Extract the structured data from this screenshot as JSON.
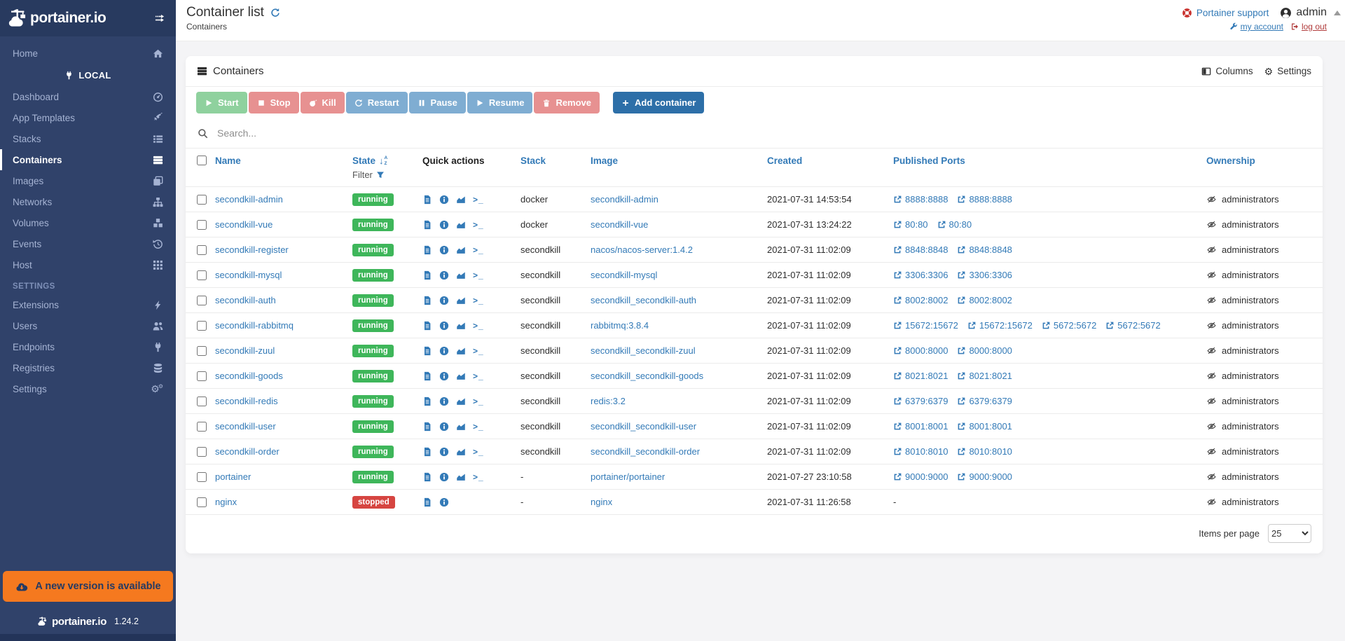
{
  "colors": {
    "blue": "#337ab7",
    "sidebar-bg": "#30426a",
    "sidebar-top": "#283a5f",
    "sidebar-text": "#a5b3d3",
    "orange": "#f5791f",
    "green": "#3eb65a",
    "red": "#d64541",
    "btn-green": "#8fd19e",
    "btn-red": "#e79191",
    "btn-blue": "#7fadd2",
    "btn-primary": "#2d6fa8",
    "logout-red": "#b13c3c",
    "text-dark": "#333333",
    "page-bg": "#f4f4f6"
  },
  "sidebar": {
    "logo_text": "portainer.io",
    "version": "1.24.2",
    "update_banner": "A new version is available",
    "local_label": "LOCAL",
    "settings_label": "SETTINGS",
    "menu": [
      {
        "label": "Home",
        "icon": "home"
      }
    ],
    "local_items": [
      {
        "label": "Dashboard",
        "icon": "gauge"
      },
      {
        "label": "App Templates",
        "icon": "rocket"
      },
      {
        "label": "Stacks",
        "icon": "stacks"
      },
      {
        "label": "Containers",
        "icon": "containers",
        "active": true
      },
      {
        "label": "Images",
        "icon": "images"
      },
      {
        "label": "Networks",
        "icon": "network"
      },
      {
        "label": "Volumes",
        "icon": "volumes"
      },
      {
        "label": "Events",
        "icon": "history"
      },
      {
        "label": "Host",
        "icon": "grid"
      }
    ],
    "settings_items": [
      {
        "label": "Extensions",
        "icon": "bolt"
      },
      {
        "label": "Users",
        "icon": "users"
      },
      {
        "label": "Endpoints",
        "icon": "plug"
      },
      {
        "label": "Registries",
        "icon": "db"
      },
      {
        "label": "Settings",
        "icon": "gears"
      }
    ]
  },
  "header": {
    "title": "Container list",
    "subtitle": "Containers",
    "support": "Portainer support",
    "user": "admin",
    "my_account": "my account",
    "log_out": "log out"
  },
  "panel": {
    "title": "Containers",
    "columns_label": "Columns",
    "settings_label": "Settings",
    "search_placeholder": "Search...",
    "buttons": [
      {
        "label": "Start",
        "icon": "play",
        "variant": "green"
      },
      {
        "label": "Stop",
        "icon": "stop",
        "variant": "red"
      },
      {
        "label": "Kill",
        "icon": "bomb",
        "variant": "red"
      },
      {
        "label": "Restart",
        "icon": "refresh",
        "variant": "blue"
      },
      {
        "label": "Pause",
        "icon": "pause",
        "variant": "blue"
      },
      {
        "label": "Resume",
        "icon": "play",
        "variant": "blue"
      },
      {
        "label": "Remove",
        "icon": "trash",
        "variant": "red"
      }
    ],
    "add_button": {
      "label": "Add container",
      "icon": "plus",
      "variant": "primary"
    },
    "table": {
      "headers": {
        "name": "Name",
        "state": "State",
        "filter": "Filter",
        "quick_actions": "Quick actions",
        "stack": "Stack",
        "image": "Image",
        "created": "Created",
        "ports": "Published Ports",
        "ownership": "Ownership"
      },
      "rows": [
        {
          "name": "secondkill-admin",
          "state": "running",
          "stack": "docker",
          "image": "secondkill-admin",
          "created": "2021-07-31 14:53:54",
          "ports": [
            "8888:8888",
            "8888:8888"
          ],
          "quick_actions": [
            "logs",
            "inspect",
            "stats",
            "console"
          ],
          "ownership": "administrators"
        },
        {
          "name": "secondkill-vue",
          "state": "running",
          "stack": "docker",
          "image": "secondkill-vue",
          "created": "2021-07-31 13:24:22",
          "ports": [
            "80:80",
            "80:80"
          ],
          "quick_actions": [
            "logs",
            "inspect",
            "stats",
            "console"
          ],
          "ownership": "administrators"
        },
        {
          "name": "secondkill-register",
          "state": "running",
          "stack": "secondkill",
          "image": "nacos/nacos-server:1.4.2",
          "created": "2021-07-31 11:02:09",
          "ports": [
            "8848:8848",
            "8848:8848"
          ],
          "quick_actions": [
            "logs",
            "inspect",
            "stats",
            "console"
          ],
          "ownership": "administrators"
        },
        {
          "name": "secondkill-mysql",
          "state": "running",
          "stack": "secondkill",
          "image": "secondkill-mysql",
          "created": "2021-07-31 11:02:09",
          "ports": [
            "3306:3306",
            "3306:3306"
          ],
          "quick_actions": [
            "logs",
            "inspect",
            "stats",
            "console"
          ],
          "ownership": "administrators"
        },
        {
          "name": "secondkill-auth",
          "state": "running",
          "stack": "secondkill",
          "image": "secondkill_secondkill-auth",
          "created": "2021-07-31 11:02:09",
          "ports": [
            "8002:8002",
            "8002:8002"
          ],
          "quick_actions": [
            "logs",
            "inspect",
            "stats",
            "console"
          ],
          "ownership": "administrators"
        },
        {
          "name": "secondkill-rabbitmq",
          "state": "running",
          "stack": "secondkill",
          "image": "rabbitmq:3.8.4",
          "created": "2021-07-31 11:02:09",
          "ports": [
            "15672:15672",
            "15672:15672",
            "5672:5672",
            "5672:5672"
          ],
          "quick_actions": [
            "logs",
            "inspect",
            "stats",
            "console"
          ],
          "ownership": "administrators"
        },
        {
          "name": "secondkill-zuul",
          "state": "running",
          "stack": "secondkill",
          "image": "secondkill_secondkill-zuul",
          "created": "2021-07-31 11:02:09",
          "ports": [
            "8000:8000",
            "8000:8000"
          ],
          "quick_actions": [
            "logs",
            "inspect",
            "stats",
            "console"
          ],
          "ownership": "administrators"
        },
        {
          "name": "secondkill-goods",
          "state": "running",
          "stack": "secondkill",
          "image": "secondkill_secondkill-goods",
          "created": "2021-07-31 11:02:09",
          "ports": [
            "8021:8021",
            "8021:8021"
          ],
          "quick_actions": [
            "logs",
            "inspect",
            "stats",
            "console"
          ],
          "ownership": "administrators"
        },
        {
          "name": "secondkill-redis",
          "state": "running",
          "stack": "secondkill",
          "image": "redis:3.2",
          "created": "2021-07-31 11:02:09",
          "ports": [
            "6379:6379",
            "6379:6379"
          ],
          "quick_actions": [
            "logs",
            "inspect",
            "stats",
            "console"
          ],
          "ownership": "administrators"
        },
        {
          "name": "secondkill-user",
          "state": "running",
          "stack": "secondkill",
          "image": "secondkill_secondkill-user",
          "created": "2021-07-31 11:02:09",
          "ports": [
            "8001:8001",
            "8001:8001"
          ],
          "quick_actions": [
            "logs",
            "inspect",
            "stats",
            "console"
          ],
          "ownership": "administrators"
        },
        {
          "name": "secondkill-order",
          "state": "running",
          "stack": "secondkill",
          "image": "secondkill_secondkill-order",
          "created": "2021-07-31 11:02:09",
          "ports": [
            "8010:8010",
            "8010:8010"
          ],
          "quick_actions": [
            "logs",
            "inspect",
            "stats",
            "console"
          ],
          "ownership": "administrators"
        },
        {
          "name": "portainer",
          "state": "running",
          "stack": "-",
          "image": "portainer/portainer",
          "created": "2021-07-27 23:10:58",
          "ports": [
            "9000:9000",
            "9000:9000"
          ],
          "quick_actions": [
            "logs",
            "inspect",
            "stats",
            "console"
          ],
          "ownership": "administrators"
        },
        {
          "name": "nginx",
          "state": "stopped",
          "stack": "-",
          "image": "nginx",
          "created": "2021-07-31 11:26:58",
          "ports": [],
          "quick_actions": [
            "logs",
            "inspect"
          ],
          "ownership": "administrators"
        }
      ]
    },
    "items_per_page_label": "Items per page",
    "items_per_page_value": "25"
  }
}
